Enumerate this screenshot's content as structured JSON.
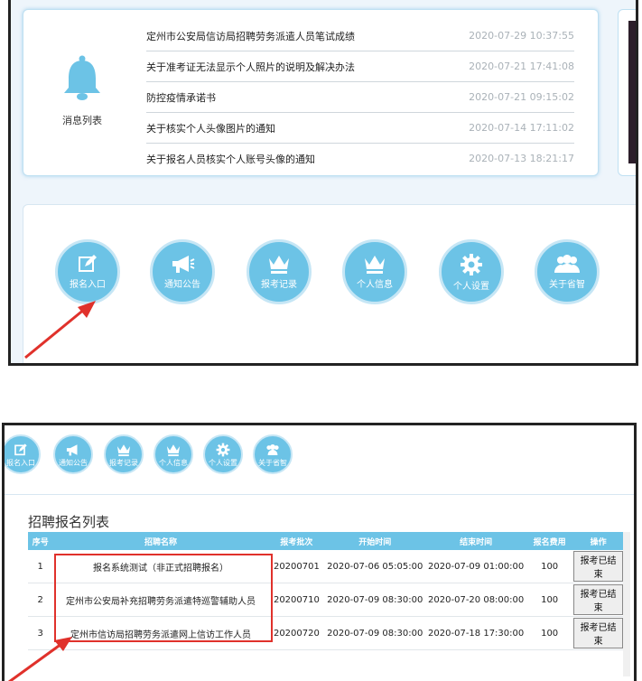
{
  "messages": {
    "section_label": "消息列表",
    "items": [
      {
        "title": "定州市公安局信访局招聘劳务派遣人员笔试成绩",
        "time": "2020-07-29 10:37:55"
      },
      {
        "title": "关于准考证无法显示个人照片的说明及解决办法",
        "time": "2020-07-21 17:41:08"
      },
      {
        "title": "防控疫情承诺书",
        "time": "2020-07-21 09:15:02"
      },
      {
        "title": "关于核实个人头像图片的通知",
        "time": "2020-07-14 17:11:02"
      },
      {
        "title": "关于报名人员核实个人账号头像的通知",
        "time": "2020-07-13 18:21:17"
      }
    ]
  },
  "nav": {
    "items": [
      {
        "label": "报名入口",
        "icon": "edit-icon"
      },
      {
        "label": "通知公告",
        "icon": "megaphone-icon"
      },
      {
        "label": "报考记录",
        "icon": "crown-icon"
      },
      {
        "label": "个人信息",
        "icon": "crown-icon"
      },
      {
        "label": "个人设置",
        "icon": "gear-icon"
      },
      {
        "label": "关于省智",
        "icon": "users-icon"
      }
    ]
  },
  "list": {
    "title": "招聘报名列表",
    "headers": [
      "序号",
      "招聘名称",
      "报考批次",
      "开始时间",
      "结束时间",
      "报名费用",
      "操作"
    ],
    "rows": [
      {
        "no": "1",
        "name": "报名系统测试（非正式招聘报名）",
        "batch": "20200701",
        "start": "2020-07-06 05:05:00",
        "end": "2020-07-09 01:00:00",
        "fee": "100",
        "action": "报考已结束"
      },
      {
        "no": "2",
        "name": "定州市公安局补充招聘劳务派遣特巡警辅助人员",
        "batch": "20200710",
        "start": "2020-07-09 08:30:00",
        "end": "2020-07-20 08:00:00",
        "fee": "100",
        "action": "报考已结束"
      },
      {
        "no": "3",
        "name": "定州市信访局招聘劳务派遣网上信访工作人员",
        "batch": "20200720",
        "start": "2020-07-09 08:30:00",
        "end": "2020-07-18 17:30:00",
        "fee": "100",
        "action": "报考已结束"
      }
    ]
  },
  "colors": {
    "accent": "#6cc3e6",
    "highlight": "#e0312b",
    "border": "#222222"
  }
}
